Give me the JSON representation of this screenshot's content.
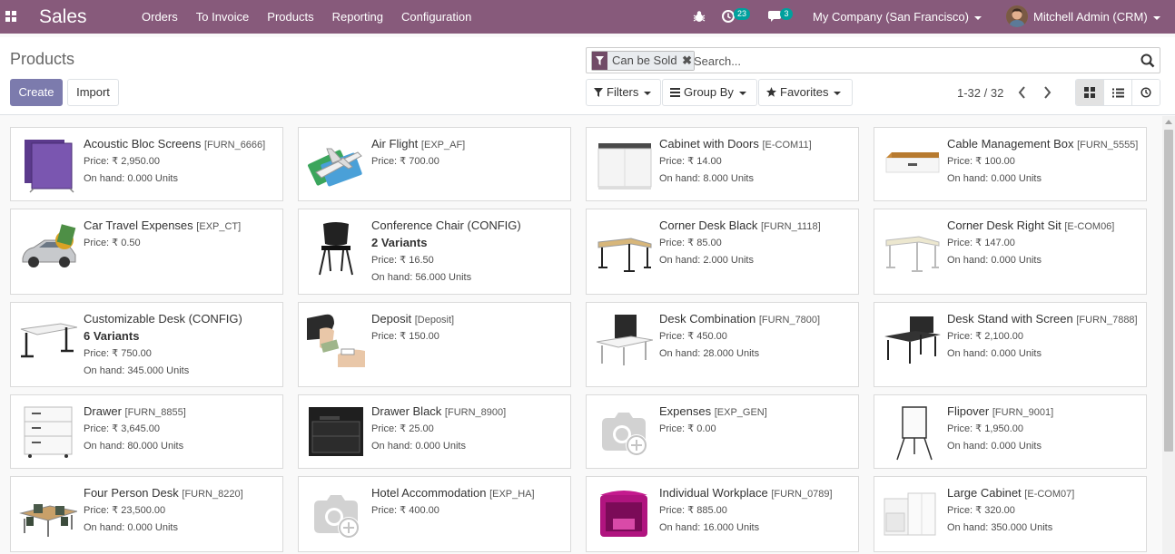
{
  "navbar": {
    "app_name": "Sales",
    "menu": [
      "Orders",
      "To Invoice",
      "Products",
      "Reporting",
      "Configuration"
    ],
    "activity_count": "23",
    "message_count": "3",
    "company": "My Company (San Francisco)",
    "user": "Mitchell Admin (CRM)",
    "color": "#875a7b"
  },
  "control_panel": {
    "title": "Products",
    "create_label": "Create",
    "import_label": "Import",
    "search": {
      "facet_label": "Can be Sold",
      "placeholder": "Search..."
    },
    "filters_label": "Filters",
    "group_by_label": "Group By",
    "favorites_label": "Favorites",
    "pager": "1-32 / 32",
    "active_view": "kanban",
    "views": [
      "kanban",
      "list",
      "activity"
    ]
  },
  "products": [
    {
      "name": "Acoustic Bloc Screens",
      "ref": "[FURN_6666]",
      "price": "Price: ₹ 2,950.00",
      "on_hand": "On hand: 0.000 Units",
      "image": "purple-panel"
    },
    {
      "name": "Air Flight",
      "ref": "[EXP_AF]",
      "price": "Price: ₹ 700.00",
      "image": "airplane"
    },
    {
      "name": "Cabinet with Doors",
      "ref": "[E-COM11]",
      "price": "Price: ₹ 14.00",
      "on_hand": "On hand: 8.000 Units",
      "image": "white-cabinet"
    },
    {
      "name": "Cable Management Box",
      "ref": "[FURN_5555]",
      "price": "Price: ₹ 100.00",
      "on_hand": "On hand: 0.000 Units",
      "image": "cable-box"
    },
    {
      "name": "Car Travel Expenses",
      "ref": "[EXP_CT]",
      "price": "Price: ₹ 0.50",
      "image": "car"
    },
    {
      "name": "Conference Chair (CONFIG)",
      "variants": "2 Variants",
      "price": "Price: ₹ 16.50",
      "on_hand": "On hand: 56.000 Units",
      "image": "chair"
    },
    {
      "name": "Corner Desk Black",
      "ref": "[FURN_1118]",
      "price": "Price: ₹ 85.00",
      "on_hand": "On hand: 2.000 Units",
      "image": "corner-desk-black"
    },
    {
      "name": "Corner Desk Right Sit",
      "ref": "[E-COM06]",
      "price": "Price: ₹ 147.00",
      "on_hand": "On hand: 0.000 Units",
      "image": "corner-desk-right"
    },
    {
      "name": "Customizable Desk (CONFIG)",
      "variants": "6 Variants",
      "price": "Price: ₹ 750.00",
      "on_hand": "On hand: 345.000 Units",
      "image": "white-desk"
    },
    {
      "name": "Deposit",
      "ref": "[Deposit]",
      "price": "Price: ₹ 150.00",
      "image": "money-hands"
    },
    {
      "name": "Desk Combination",
      "ref": "[FURN_7800]",
      "price": "Price: ₹ 450.00",
      "on_hand": "On hand: 28.000 Units",
      "image": "desk-combination"
    },
    {
      "name": "Desk Stand with Screen",
      "ref": "[FURN_7888]",
      "price": "Price: ₹ 2,100.00",
      "on_hand": "On hand: 0.000 Units",
      "image": "desk-stand-screen"
    },
    {
      "name": "Drawer",
      "ref": "[FURN_8855]",
      "price": "Price: ₹ 3,645.00",
      "on_hand": "On hand: 80.000 Units",
      "image": "white-drawer"
    },
    {
      "name": "Drawer Black",
      "ref": "[FURN_8900]",
      "price": "Price: ₹ 25.00",
      "on_hand": "On hand: 0.000 Units",
      "image": "black-drawer"
    },
    {
      "name": "Expenses",
      "ref": "[EXP_GEN]",
      "price": "Price: ₹ 0.00",
      "image": "camera-placeholder"
    },
    {
      "name": "Flipover",
      "ref": "[FURN_9001]",
      "price": "Price: ₹ 1,950.00",
      "on_hand": "On hand: 0.000 Units",
      "image": "flipchart"
    },
    {
      "name": "Four Person Desk",
      "ref": "[FURN_8220]",
      "price": "Price: ₹ 23,500.00",
      "on_hand": "On hand: 0.000 Units",
      "image": "four-person-desk"
    },
    {
      "name": "Hotel Accommodation",
      "ref": "[EXP_HA]",
      "price": "Price: ₹ 400.00",
      "image": "camera-placeholder"
    },
    {
      "name": "Individual Workplace",
      "ref": "[FURN_0789]",
      "price": "Price: ₹ 885.00",
      "on_hand": "On hand: 16.000 Units",
      "image": "pink-booth"
    },
    {
      "name": "Large Cabinet",
      "ref": "[E-COM07]",
      "price": "Price: ₹ 320.00",
      "on_hand": "On hand: 350.000 Units",
      "image": "large-cabinet"
    }
  ]
}
